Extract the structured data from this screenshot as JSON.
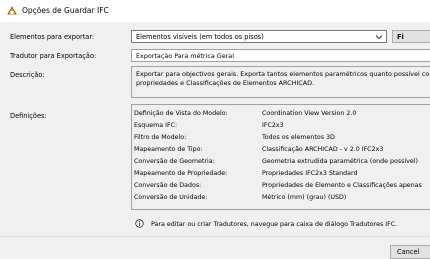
{
  "window": {
    "title": "Opções de Guardar IFC"
  },
  "form": {
    "elements_label": "Elementos para exportar:",
    "elements_value": "Elementos visíveis (em todos os pisos)",
    "side_button_label": "Fi",
    "translator_label": "Tradutor para Exportação:",
    "translator_value": "Exportação Para métrica Geral",
    "description_label": "Descrição:",
    "description_lines": [
      "Exportar para objectivos gerais. Exporta tantos elementos paramétricos quanto possível co",
      "propriedades e Classificações de Elementos ARCHICAD."
    ],
    "definitions_label": "Definições:"
  },
  "definitions": [
    {
      "key": "Definição de Vista do Modelo:",
      "value": "Coordination View Version 2.0"
    },
    {
      "key": "Esquema IFC:",
      "value": "IFC2x3"
    },
    {
      "key": "Filtro de Modelo:",
      "value": "Todos os elementos 3D"
    },
    {
      "key": "Mapeamento de Tipo:",
      "value": "Classificação ARCHICAD - v 2.0 IFC2x3"
    },
    {
      "key": "Conversão de Geometria:",
      "value": "Geometria extrudida paramétrica (onde possível)"
    },
    {
      "key": "Mapeamento de Propriedade:",
      "value": "Propriedades IFC2x3 Standard"
    },
    {
      "key": "Conversão de Dados:",
      "value": "Propriedades de Elemento e Classificações apenas"
    },
    {
      "key": "Conversão de Unidade:",
      "value": "Métrico (mm) (grau) (USD)"
    }
  ],
  "info": {
    "text": "Para editar ou criar Tradutores, navegue para caixa de diálogo Tradutores IFC."
  },
  "buttons": {
    "cancel": "Cancel"
  }
}
